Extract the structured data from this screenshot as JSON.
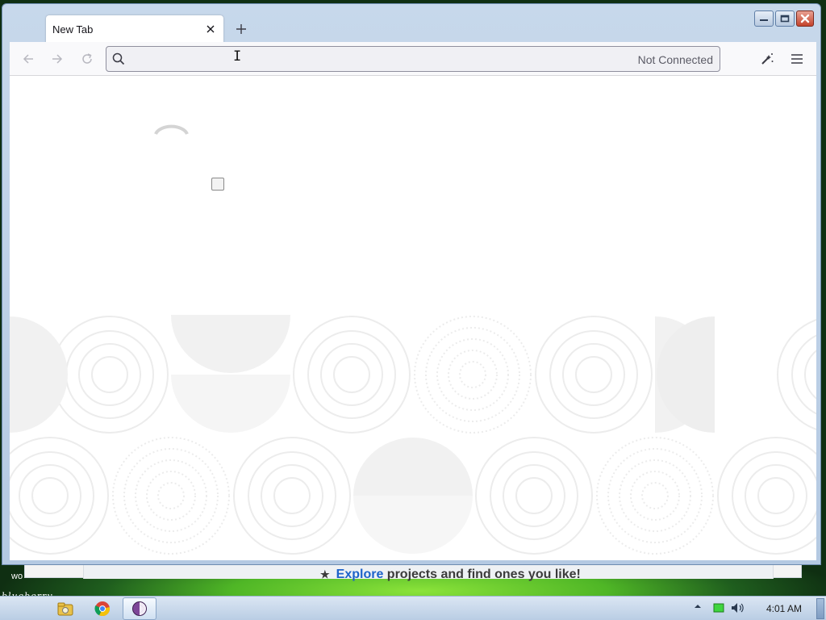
{
  "browser": {
    "tab_title": "New Tab",
    "url_value": "",
    "connection_status": "Not Connected"
  },
  "window_controls": {
    "minimize": "minimize-icon",
    "maximize": "maximize-icon",
    "close": "close-icon"
  },
  "toolbar_icons": [
    "back-icon",
    "forward-icon",
    "reload-icon",
    "search-icon",
    "customize-icon",
    "menu-icon"
  ],
  "background_window": {
    "banner_link": "Explore",
    "banner_rest": " projects and find ones you like!",
    "left_text": "wo"
  },
  "desktop": {
    "scribble": "blueberry\nanety"
  },
  "taskbar": {
    "apps": [
      "file-explorer-icon",
      "chrome-icon",
      "tor-browser-icon"
    ],
    "clock": "4:01 AM"
  },
  "colors": {
    "frame": "#c7d8eb",
    "toolbar": "#f9f9fb",
    "content": "#ffffff",
    "close_button": "#c4432c",
    "link": "#1d63c9"
  }
}
